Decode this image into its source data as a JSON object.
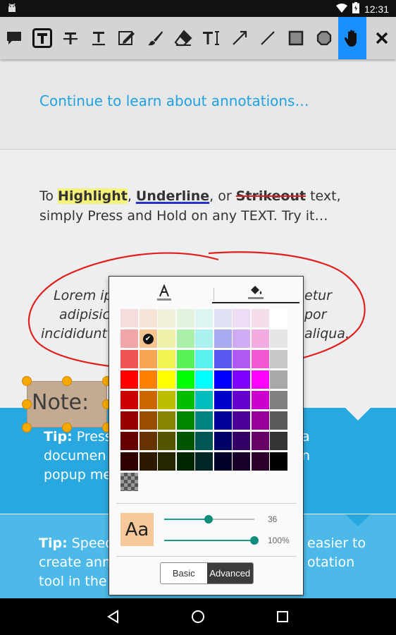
{
  "status_bar": {
    "time": "12:31"
  },
  "toolbar": {
    "tools": [
      "note-icon",
      "text-box-icon",
      "strikethrough-icon",
      "text-icon",
      "signature-icon",
      "freehand-icon",
      "eraser-icon",
      "text-insert-icon",
      "arrow-icon",
      "line-icon",
      "rectangle-icon",
      "polygon-icon",
      "pan-hand-icon",
      "close-icon"
    ],
    "active_tool": "pan-hand-icon",
    "active_color": "#1a90ff"
  },
  "document": {
    "continue_link": "Continue to learn about annotations…",
    "instructions": {
      "prefix": "To ",
      "highlight": "Highlight",
      "comma1": ", ",
      "underline": "Underline",
      "or": ", or ",
      "strikeout": "Strikeout",
      "suffix": " text, simply Press and Hold on any TEXT. Try it…"
    },
    "lorem_visible": {
      "line1_left": "Lorem ip",
      "line1_right": "etur",
      "line2_left": "adipisic",
      "line2_right": "por",
      "line3_left": "incididunt",
      "line3_right": "aliqua."
    },
    "note_label": "Note:",
    "tip1": {
      "label": "Tip:",
      "line1_left": "Press",
      "line1_right": "a",
      "line2_left": "documen",
      "line2_right": "n",
      "line3_left": "popup me"
    },
    "tip2": {
      "label": "Tip:",
      "line1_left": "Speed",
      "line1_right": "easier to",
      "line2_left": "create ann",
      "line2_right": "otation",
      "line3_left": "tool in the"
    }
  },
  "color_picker": {
    "tabs": [
      "text-color-icon",
      "fill-color-icon"
    ],
    "selected_tab": "fill-color-icon",
    "swatch_rows": [
      [
        "#f6dcdc",
        "#f6e4d7",
        "#f2f2dc",
        "#e2f4de",
        "#dcf4f2",
        "#e0e0f4",
        "#ecdcf4",
        "#f6ddec",
        "#ffffff"
      ],
      [
        "#f2a6a6",
        "#f6c48e",
        "#eef2a8",
        "#aaf0aa",
        "#aaf0ec",
        "#aaaaf2",
        "#d0aaf2",
        "#f2aae0",
        "#e6e6e6"
      ],
      [
        "#f25454",
        "#f6a552",
        "#f2f252",
        "#58f258",
        "#58f2ee",
        "#5858f2",
        "#b058f2",
        "#f258d2",
        "#c8c8c8"
      ],
      [
        "#ff0000",
        "#ff8000",
        "#ffff00",
        "#00ff00",
        "#00ffff",
        "#0000ff",
        "#8000ff",
        "#ff00ff",
        "#a8a8a8"
      ],
      [
        "#cc0000",
        "#cc6600",
        "#bdbd00",
        "#00bd00",
        "#00bdbd",
        "#0000cc",
        "#6600cc",
        "#cc00cc",
        "#808080"
      ],
      [
        "#990000",
        "#994d00",
        "#858500",
        "#008500",
        "#008585",
        "#000099",
        "#4d0099",
        "#990099",
        "#5a5a5a"
      ],
      [
        "#660000",
        "#663300",
        "#555500",
        "#005500",
        "#005555",
        "#000066",
        "#330066",
        "#660066",
        "#333333"
      ],
      [
        "#2e0000",
        "#2b1a00",
        "#262600",
        "#002600",
        "#002626",
        "#00002b",
        "#18002b",
        "#2b002b",
        "#000000"
      ]
    ],
    "selected_swatch": "row-1-col-1",
    "transparent_swatch": "transparent-icon",
    "preview_label": "Aa",
    "preview_color": "#f6c89a",
    "thickness": {
      "value": "36",
      "fraction": 0.49
    },
    "opacity": {
      "value": "100%",
      "fraction": 1.0
    },
    "modes": {
      "basic": "Basic",
      "advanced": "Advanced",
      "selected": "advanced"
    }
  },
  "nav_bar": {
    "buttons": [
      "back-icon",
      "home-icon",
      "recents-icon"
    ]
  }
}
